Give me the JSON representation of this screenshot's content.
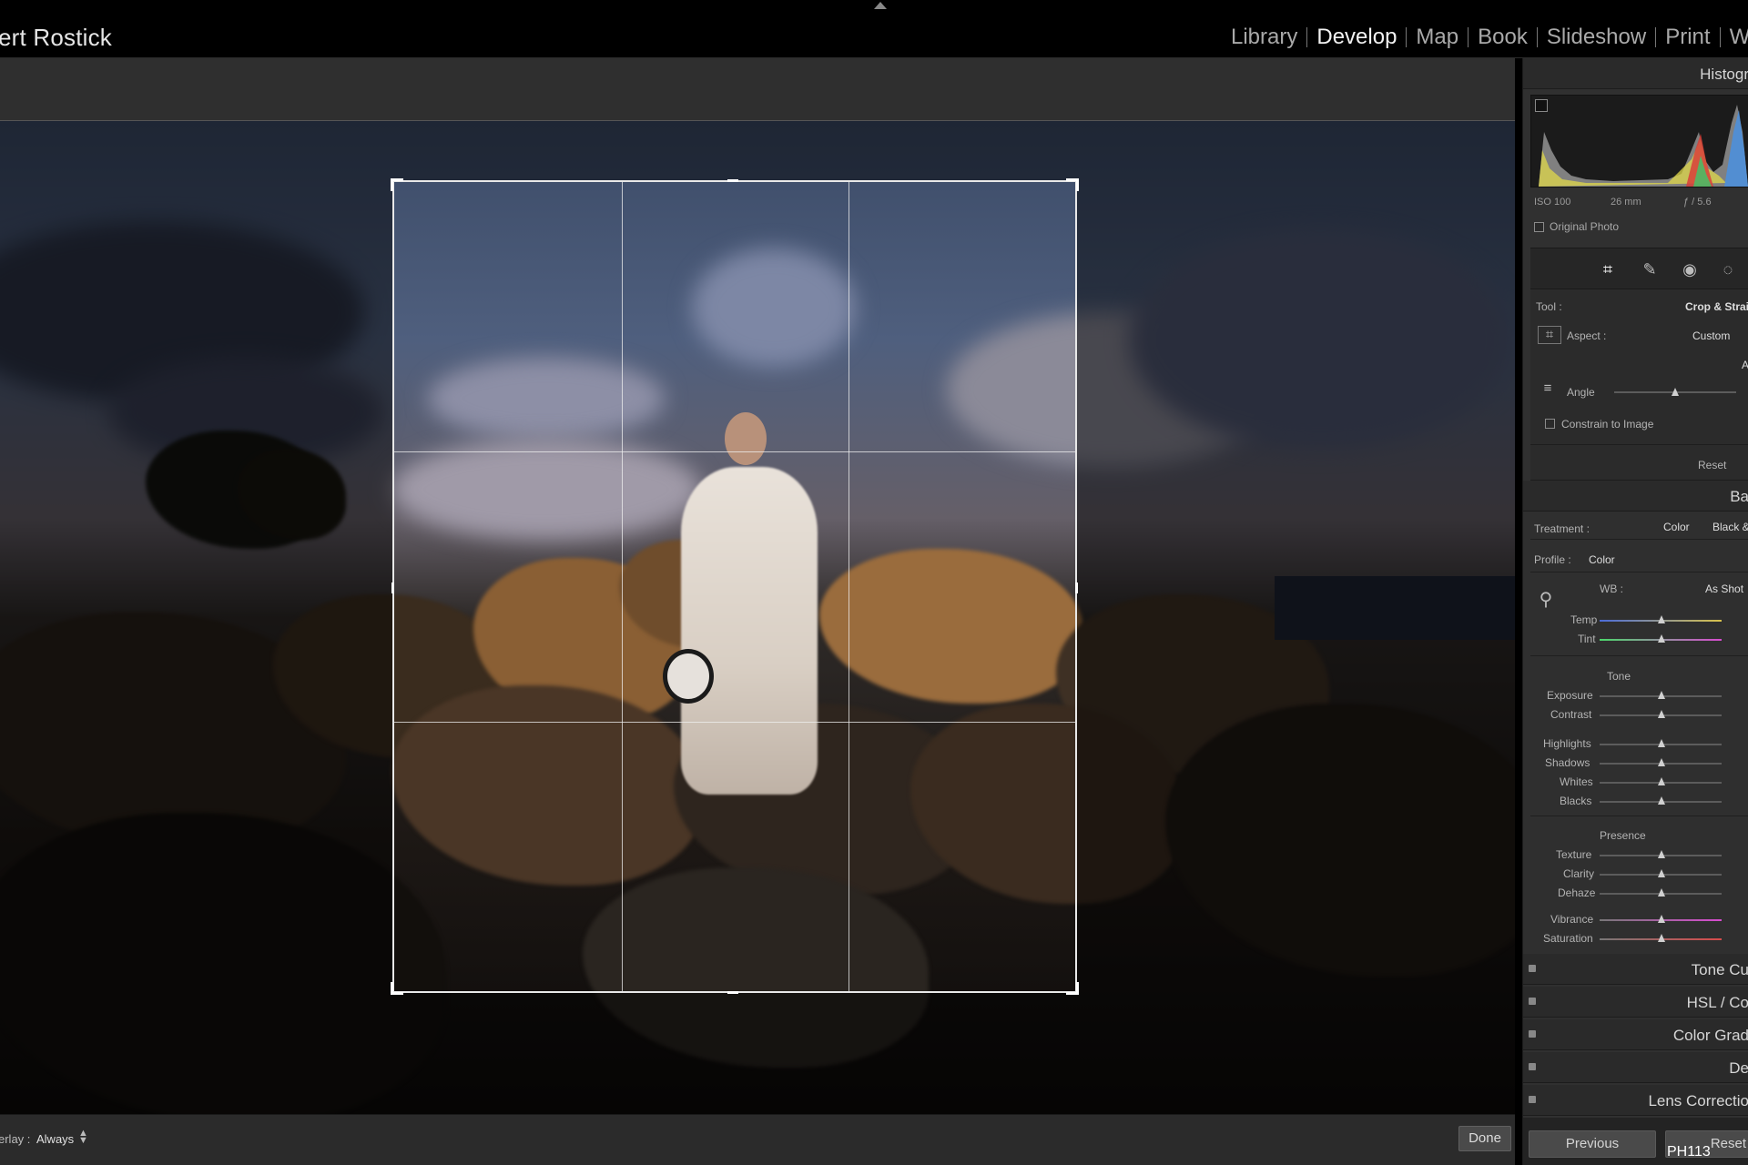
{
  "identity_plate": "ert Rostick",
  "modules": [
    "Library",
    "Develop",
    "Map",
    "Book",
    "Slideshow",
    "Print",
    "We"
  ],
  "active_module": "Develop",
  "canvas_toolbar": {
    "overlay_label": "erlay :",
    "overlay_value": "Always",
    "done_label": "Done"
  },
  "histogram": {
    "title": "Histogr",
    "iso": "ISO 100",
    "focal_length": "26 mm",
    "aperture": "ƒ / 5.6",
    "original_photo_label": "Original Photo"
  },
  "tools": [
    "crop-icon",
    "healing-brush-icon",
    "red-eye-icon",
    "masking-icon"
  ],
  "crop_panel": {
    "tool_label": "Tool :",
    "tool_value": "Crop & Strai",
    "aspect_label": "Aspect :",
    "aspect_value": "Custom",
    "auto_label": "A",
    "angle_label": "Angle",
    "angle_value": 0.5,
    "constrain_label": "Constrain to Image",
    "reset_label": "Reset"
  },
  "basic_panel": {
    "title": "Ba",
    "treatment_label": "Treatment :",
    "treatment_color": "Color",
    "treatment_bw": "Black &",
    "profile_label": "Profile :",
    "profile_value": "Color",
    "wb_label": "WB :",
    "wb_value": "As Shot",
    "temp_label": "Temp",
    "tint_label": "Tint",
    "tone_title": "Tone",
    "exposure_label": "Exposure",
    "contrast_label": "Contrast",
    "highlights_label": "Highlights",
    "shadows_label": "Shadows",
    "whites_label": "Whites",
    "blacks_label": "Blacks",
    "presence_title": "Presence",
    "texture_label": "Texture",
    "clarity_label": "Clarity",
    "dehaze_label": "Dehaze",
    "vibrance_label": "Vibrance",
    "saturation_label": "Saturation"
  },
  "collapsed_panels": [
    "Tone Cu",
    "HSL / Co",
    "Color Grad",
    "De",
    "Lens Correctio"
  ],
  "bottom_buttons": {
    "previous_label": "Previous",
    "reset_label": "Reset"
  },
  "watermark": "PH113",
  "colors": {
    "background": "#000000",
    "panel": "#303030",
    "crop_border": "#e8e8e8"
  }
}
